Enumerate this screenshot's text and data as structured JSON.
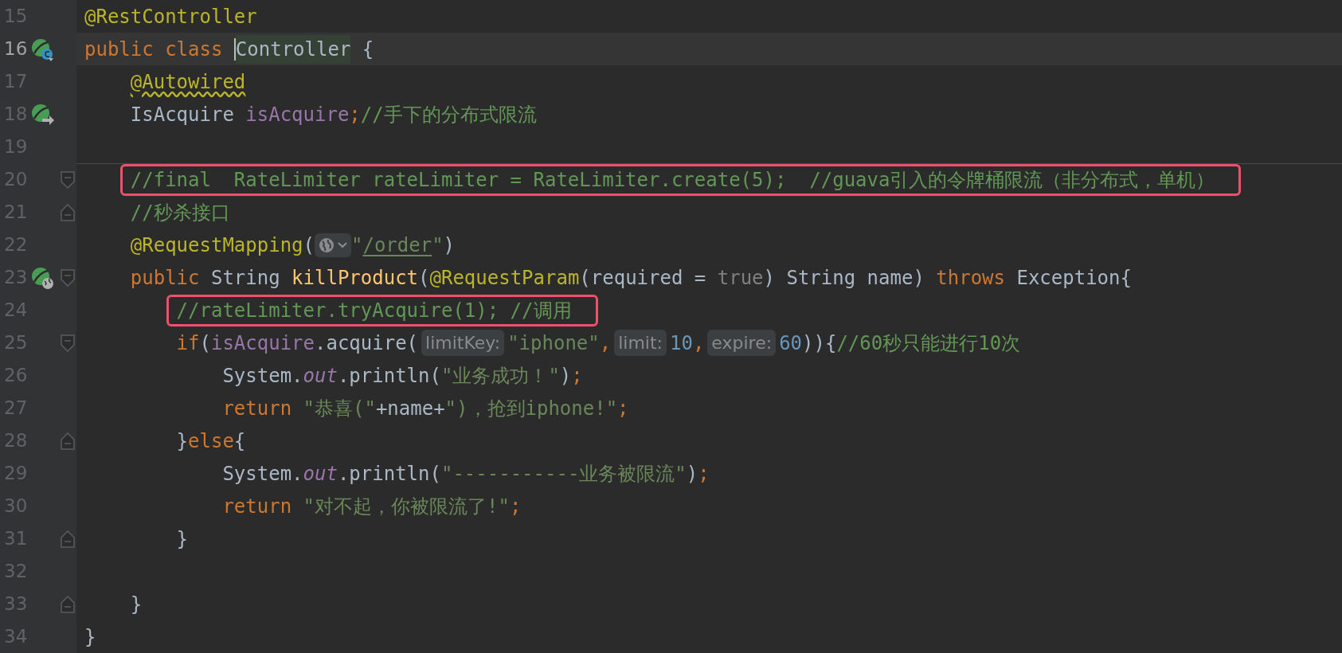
{
  "editor": {
    "lines": [
      {
        "number": "15",
        "current": false,
        "tokens": [
          {
            "kind": "ann",
            "text": "@RestController"
          }
        ]
      },
      {
        "number": "16",
        "current": true,
        "gutter_icon": {
          "kind": "class"
        },
        "tokens": [
          {
            "kind": "kw",
            "text": "public class "
          },
          {
            "kind": "usage",
            "text": "Controller",
            "cursor": true
          },
          {
            "kind": "plain",
            "text": " {"
          }
        ]
      },
      {
        "number": "17",
        "current": false,
        "tokens": [
          {
            "kind": "ann_warn",
            "text": "    @Autowired"
          }
        ]
      },
      {
        "number": "18",
        "current": false,
        "gutter_icon": {
          "kind": "autowired"
        },
        "tokens": [
          {
            "kind": "plain",
            "text": "    IsAcquire "
          },
          {
            "kind": "field",
            "text": "isAcquire"
          },
          {
            "kind": "kw",
            "text": ";"
          },
          {
            "kind": "comment",
            "text": "//手下的分布式限流"
          }
        ]
      },
      {
        "number": "19",
        "current": false
      },
      {
        "number": "20",
        "current": false,
        "boxed": true,
        "separator_above": true,
        "fold": {
          "kind": "start"
        },
        "tokens": [
          {
            "kind": "comment",
            "text": "    //final  RateLimiter rateLimiter = RateLimiter.create(5);  //guava引入的令牌桶限流（非分布式，单机）"
          }
        ]
      },
      {
        "number": "21",
        "current": false,
        "fold": {
          "kind": "end"
        },
        "tokens": [
          {
            "kind": "comment",
            "text": "    //秒杀接口"
          }
        ]
      },
      {
        "number": "22",
        "current": false,
        "tokens": [
          {
            "kind": "ann",
            "text": "    @RequestMapping"
          },
          {
            "kind": "plain",
            "text": "("
          },
          {
            "kind": "url_inlay"
          },
          {
            "kind": "str",
            "text": "\""
          },
          {
            "kind": "url",
            "text": "/order"
          },
          {
            "kind": "str",
            "text": "\""
          },
          {
            "kind": "plain",
            "text": ")"
          }
        ]
      },
      {
        "number": "23",
        "current": false,
        "gutter_icon": {
          "kind": "endpoint"
        },
        "fold": {
          "kind": "start"
        },
        "tokens": [
          {
            "kind": "kw",
            "text": "    public "
          },
          {
            "kind": "plain",
            "text": "String "
          },
          {
            "kind": "method",
            "text": "killProduct"
          },
          {
            "kind": "plain",
            "text": "("
          },
          {
            "kind": "ann",
            "text": "@RequestParam"
          },
          {
            "kind": "plain",
            "text": "(required = "
          },
          {
            "kind": "muted",
            "text": "true"
          },
          {
            "kind": "plain",
            "text": ") String name) "
          },
          {
            "kind": "kw",
            "text": "throws "
          },
          {
            "kind": "plain",
            "text": "Exception{"
          }
        ]
      },
      {
        "number": "24",
        "current": false,
        "boxed": true,
        "tokens": [
          {
            "kind": "comment",
            "text": "        //rateLimiter.tryAcquire(1); //调用"
          }
        ]
      },
      {
        "number": "25",
        "current": false,
        "fold": {
          "kind": "start"
        },
        "tokens": [
          {
            "kind": "kw",
            "text": "        if"
          },
          {
            "kind": "plain",
            "text": "("
          },
          {
            "kind": "field",
            "text": "isAcquire"
          },
          {
            "kind": "plain",
            "text": ".acquire("
          },
          {
            "kind": "hint",
            "text": "limitKey:"
          },
          {
            "kind": "str",
            "text": "\"iphone\""
          },
          {
            "kind": "kw",
            "text": ","
          },
          {
            "kind": "hint",
            "text": "limit:"
          },
          {
            "kind": "num",
            "text": "10"
          },
          {
            "kind": "kw",
            "text": ","
          },
          {
            "kind": "hint",
            "text": "expire:"
          },
          {
            "kind": "num",
            "text": "60"
          },
          {
            "kind": "plain",
            "text": ")){"
          },
          {
            "kind": "comment",
            "text": "//60秒只能进行10次"
          }
        ]
      },
      {
        "number": "26",
        "current": false,
        "tokens": [
          {
            "kind": "plain",
            "text": "            System."
          },
          {
            "kind": "static",
            "text": "out"
          },
          {
            "kind": "plain",
            "text": ".println("
          },
          {
            "kind": "str",
            "text": "\"业务成功！\""
          },
          {
            "kind": "plain",
            "text": ")"
          },
          {
            "kind": "kw",
            "text": ";"
          }
        ]
      },
      {
        "number": "27",
        "current": false,
        "tokens": [
          {
            "kind": "kw",
            "text": "            return "
          },
          {
            "kind": "str",
            "text": "\"恭喜(\""
          },
          {
            "kind": "plain",
            "text": "+name+"
          },
          {
            "kind": "str",
            "text": "\")，抢到iphone!\""
          },
          {
            "kind": "kw",
            "text": ";"
          }
        ]
      },
      {
        "number": "28",
        "current": false,
        "fold": {
          "kind": "end"
        },
        "tokens": [
          {
            "kind": "plain",
            "text": "        }"
          },
          {
            "kind": "kw",
            "text": "else"
          },
          {
            "kind": "plain",
            "text": "{"
          }
        ]
      },
      {
        "number": "29",
        "current": false,
        "tokens": [
          {
            "kind": "plain",
            "text": "            System."
          },
          {
            "kind": "static",
            "text": "out"
          },
          {
            "kind": "plain",
            "text": ".println("
          },
          {
            "kind": "str",
            "text": "\"-----------业务被限流\""
          },
          {
            "kind": "plain",
            "text": ")"
          },
          {
            "kind": "kw",
            "text": ";"
          }
        ]
      },
      {
        "number": "30",
        "current": false,
        "tokens": [
          {
            "kind": "kw",
            "text": "            return "
          },
          {
            "kind": "str",
            "text": "\"对不起，你被限流了!\""
          },
          {
            "kind": "kw",
            "text": ";"
          }
        ]
      },
      {
        "number": "31",
        "current": false,
        "fold": {
          "kind": "end"
        },
        "tokens": [
          {
            "kind": "plain",
            "text": "        }"
          }
        ]
      },
      {
        "number": "32",
        "current": false
      },
      {
        "number": "33",
        "current": false,
        "fold": {
          "kind": "end"
        },
        "tokens": [
          {
            "kind": "plain",
            "text": "    }"
          }
        ]
      },
      {
        "number": "34",
        "current": false,
        "tokens": [
          {
            "kind": "plain",
            "text": "}"
          }
        ]
      }
    ]
  }
}
